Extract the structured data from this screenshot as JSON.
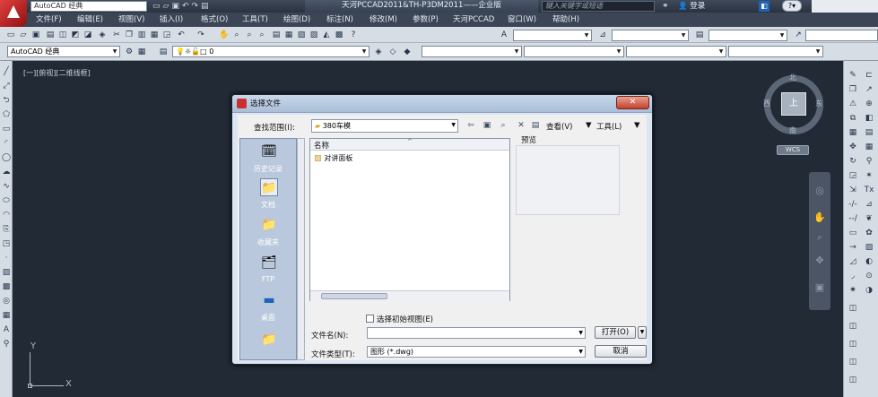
{
  "titlebar": {
    "workspace_combo": "AutoCAD 经典",
    "title": "天河PCCAD2011&TH-P3DM2011——企业版",
    "search_placeholder": "键入关键字或短语",
    "login_label": "登录"
  },
  "menubar": {
    "items": [
      "文件(F)",
      "编辑(E)",
      "视图(V)",
      "插入(I)",
      "格式(O)",
      "工具(T)",
      "绘图(D)",
      "标注(N)",
      "修改(M)",
      "参数(P)",
      "天河PCCAD",
      "窗口(W)",
      "帮助(H)"
    ]
  },
  "toolbar2": {
    "workspace": "AutoCAD 经典",
    "layer": "0"
  },
  "canvas": {
    "viewport_label": "[一][俯视][二维线框]",
    "viewcube": {
      "top": "上",
      "north": "北",
      "south": "南",
      "east": "东",
      "west": "西",
      "wcs": "WCS"
    },
    "ucs": {
      "x": "X",
      "y": "Y"
    }
  },
  "dialog": {
    "title": "选择文件",
    "close_label": "✕",
    "lookin_label": "查找范围(I):",
    "lookin_value": "380车模",
    "view_menu": "查看(V)",
    "tools_menu": "工具(L)",
    "places": [
      "历史记录",
      "文档",
      "收藏夹",
      "FTP",
      "桌面"
    ],
    "column_name": "名称",
    "files": [
      "对讲面板"
    ],
    "preview_label": "预览",
    "initial_view_label": "选择初始视图(E)",
    "filename_label": "文件名(N):",
    "filename_value": "",
    "filetype_label": "文件类型(T):",
    "filetype_value": "图形 (*.dwg)",
    "open_button": "打开(O)",
    "cancel_button": "取消"
  },
  "icons": {
    "places": [
      "history-icon",
      "documents-icon",
      "favorites-icon",
      "ftp-icon",
      "desktop-icon"
    ]
  }
}
